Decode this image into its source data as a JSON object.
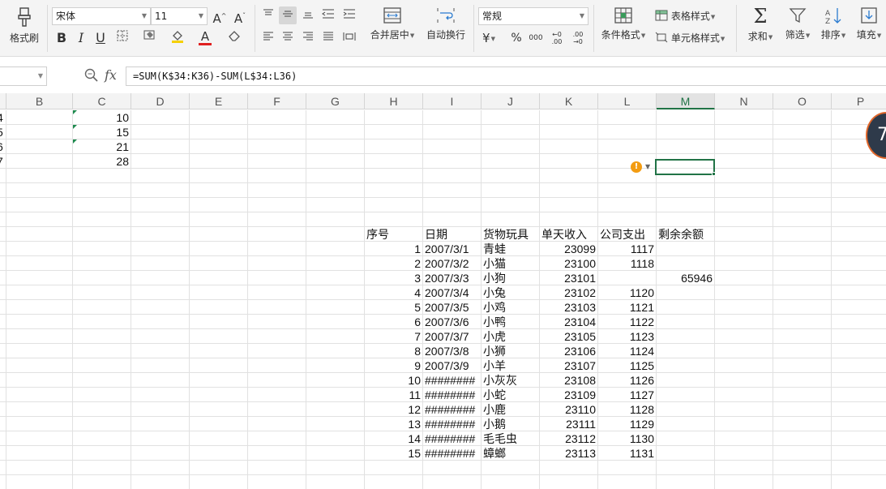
{
  "ribbon": {
    "format_painter_label": "格式刷",
    "font_name": "宋体",
    "font_size": "11",
    "merge_center_label": "合并居中",
    "wrap_text_label": "自动换行",
    "number_format": "常规",
    "conditional_format_label": "条件格式",
    "table_style_label": "表格样式",
    "cell_style_label": "单元格样式",
    "sum_label": "求和",
    "filter_label": "筛选",
    "sort_label": "排序",
    "fill_label": "填充"
  },
  "formula_bar": {
    "fx": "fx",
    "formula": "=SUM(K$34:K36)-SUM(L$34:L36)"
  },
  "columns": [
    "B",
    "C",
    "D",
    "E",
    "F",
    "G",
    "H",
    "I",
    "J",
    "K",
    "L",
    "M",
    "N",
    "O",
    "P"
  ],
  "active_column": "M",
  "left_partial": [
    "4",
    "5",
    "6",
    "7"
  ],
  "c_values": [
    "10",
    "15",
    "21",
    "28"
  ],
  "table": {
    "headers": [
      "序号",
      "日期",
      "货物玩具",
      "单天收入",
      "公司支出",
      "剩余余额"
    ],
    "rows": [
      [
        "1",
        "2007/3/1",
        "青蛙",
        "23099",
        "1117",
        ""
      ],
      [
        "2",
        "2007/3/2",
        "小猫",
        "23100",
        "1118",
        ""
      ],
      [
        "3",
        "2007/3/3",
        "小狗",
        "23101",
        "",
        "65946"
      ],
      [
        "4",
        "2007/3/4",
        "小兔",
        "23102",
        "1120",
        ""
      ],
      [
        "5",
        "2007/3/5",
        "小鸡",
        "23103",
        "1121",
        ""
      ],
      [
        "6",
        "2007/3/6",
        "小鸭",
        "23104",
        "1122",
        ""
      ],
      [
        "7",
        "2007/3/7",
        "小虎",
        "23105",
        "1123",
        ""
      ],
      [
        "8",
        "2007/3/8",
        "小狮",
        "23106",
        "1124",
        ""
      ],
      [
        "9",
        "2007/3/9",
        "小羊",
        "23107",
        "1125",
        ""
      ],
      [
        "10",
        "########",
        "小灰灰",
        "23108",
        "1126",
        ""
      ],
      [
        "11",
        "########",
        "小蛇",
        "23109",
        "1127",
        ""
      ],
      [
        "12",
        "########",
        "小鹿",
        "23110",
        "1128",
        ""
      ],
      [
        "13",
        "########",
        "小鹅",
        "23111",
        "1129",
        ""
      ],
      [
        "14",
        "########",
        "毛毛虫",
        "23112",
        "1130",
        ""
      ],
      [
        "15",
        "########",
        "蟑螂",
        "23113",
        "1131",
        ""
      ]
    ]
  },
  "error_indicator": "!",
  "floating_badge": "7",
  "colors": {
    "selection": "#217346",
    "error": "#f39c12",
    "font_red": "#e02020",
    "highlight_yellow": "#f5d000"
  },
  "icons": [
    "format-painter-icon",
    "bold-icon",
    "italic-icon",
    "underline-icon",
    "border-icon",
    "fill-color-icon",
    "font-color-icon",
    "eraser-icon",
    "merge-icon",
    "wrap-icon",
    "currency-icon",
    "percent-icon",
    "conditional-format-icon",
    "table-style-icon",
    "cell-style-icon",
    "sum-icon",
    "filter-icon",
    "sort-icon",
    "fill-icon",
    "zoom-icon"
  ]
}
